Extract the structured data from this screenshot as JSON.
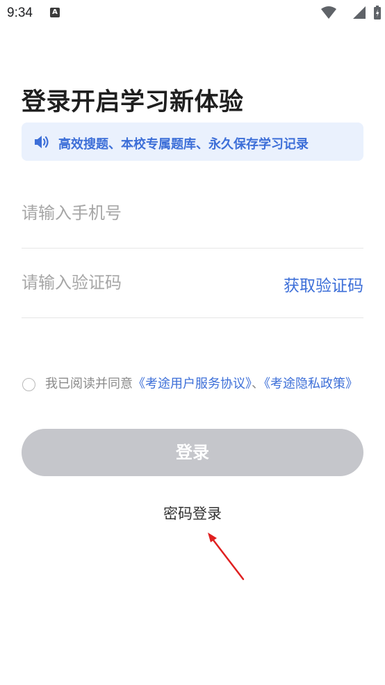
{
  "status_bar": {
    "time": "9:34",
    "notification_icon": "A"
  },
  "login": {
    "title": "登录开启学习新体验",
    "notice": "高效搜题、本校专属题库、永久保存学习记录",
    "phone_placeholder": "请输入手机号",
    "code_placeholder": "请输入验证码",
    "get_code_label": "获取验证码",
    "agree_prefix": "我已阅读并同意",
    "agreement_link": "《考途用户服务协议》",
    "agree_separator": "、",
    "privacy_link": "《考途隐私政策》",
    "login_button": "登录",
    "password_login": "密码登录"
  },
  "colors": {
    "accent": "#3d6fd8",
    "notice_bg": "#eaf1fd",
    "button_disabled": "#c5c6cb",
    "arrow": "#e02020"
  },
  "icons": {
    "notice": "speaker-icon",
    "wifi": "wifi-icon",
    "cell": "cell-signal-icon",
    "battery": "battery-icon"
  }
}
